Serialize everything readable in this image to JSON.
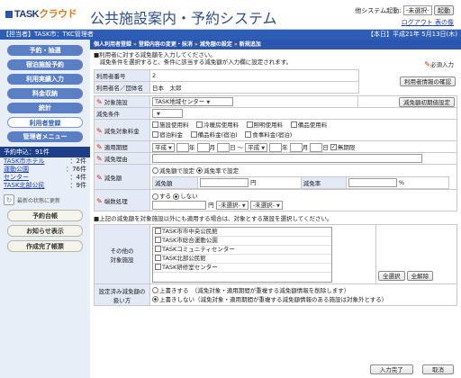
{
  "header": {
    "logo_text": "TASK",
    "logo_accent": "クラウド",
    "app_title": "公共施設案内・予約システム",
    "user_label": "他システム起動:",
    "system_select": "-未選択-",
    "launch_button": "起動",
    "logout_link": "ログアウト",
    "help_link": "表の像"
  },
  "topbar": {
    "left": "【担当者】TASK市：TKC管理者",
    "right": "【本日】平成21年 5月13日(木)"
  },
  "sidebar": {
    "nav": [
      "予約・抽選",
      "宿泊施設予約",
      "利用実績入力",
      "料金収納",
      "統計",
      "利用者登録",
      "管理者メニュー"
    ],
    "active_index": 5,
    "reservations_header": "予約申込：91件",
    "counts": [
      {
        "label": "TASK市ホテル",
        "value": "：2件"
      },
      {
        "label": "運動公園",
        "value": "：76件"
      },
      {
        "label": "センター",
        "value": "：4件"
      },
      {
        "label": "TASK北部公民",
        "value": "：9件"
      }
    ],
    "refresh_label": "最新の状態に更新",
    "buttons": [
      "予約台帳",
      "お知らせ表示",
      "作成完了帳票"
    ]
  },
  "main": {
    "breadcrumb": [
      "個人利用者登録",
      "登録内容の変更・抹消",
      "減免額の設定",
      "新規追加"
    ],
    "note1": "■利用者に対する減免額を入力してください。",
    "note2": "　減免条件を選択すると、条件に該当する減免額が入力欄に設定されます。",
    "required_label": "必須入力",
    "user_no_label": "利用者番号",
    "user_no": "2",
    "user_name_label": "利用者名／団体名",
    "user_name": "日本　太郎",
    "user_info_button": "利用者情報の確認",
    "facility_label": "対象施設",
    "facility_value": "TASK地域センター",
    "initial_button": "減免額初期値設定",
    "condition_label": "減免条件",
    "condition_value": "",
    "target_fee_label": "減免対象料金",
    "fees": [
      "施設使用料",
      "冷暖房使用料",
      "照明使用料",
      "備品使用料",
      "宿泊料金",
      "備品料金(宿泊)",
      "食事料金(宿泊)"
    ],
    "period_label": "適用期間",
    "era1": "平成",
    "era2": "平成",
    "year": "年",
    "month": "月",
    "day": "日",
    "tilde": "～",
    "no_limit": "無期限",
    "reason_label": "減免理由",
    "amount_label": "減免額",
    "amount_opt1": "減免額で設定",
    "amount_opt2": "減免率で設定",
    "amount_sub": "減免額",
    "amount_unit": "円",
    "rate_sub": "減免率",
    "rate_unit": "%",
    "rounding_label": "端数処理",
    "rounding_opt1": "する",
    "rounding_opt2": "しない",
    "rounding_unit": "円",
    "rounding_sel1": "-未選択-",
    "rounding_sel2": "-未選択-",
    "note3": "■上記の減免額を対象施設以外にも適用する場合は、対象とする施設を選択してください。",
    "other_label": "その他の\n対象施設",
    "other_facilities": [
      "TASK市市中央公民館",
      "TASK市総合運動公園",
      "TASKコミュニティセンター",
      "TASK北部公民館",
      "TASK研修室センター"
    ],
    "select_all": "全選択",
    "clear_all": "全解除",
    "existing_label": "設定済み減免額の\n扱い方",
    "existing_opt1": "上書きする　（減免対象・適用期間が重複する減免額情報を削除します）",
    "existing_opt2": "上書きしない（減免対象・適用期間が重複する減免額情報のある施設は対象外とする）",
    "complete_button": "入力完了",
    "cancel_button": "取消"
  }
}
